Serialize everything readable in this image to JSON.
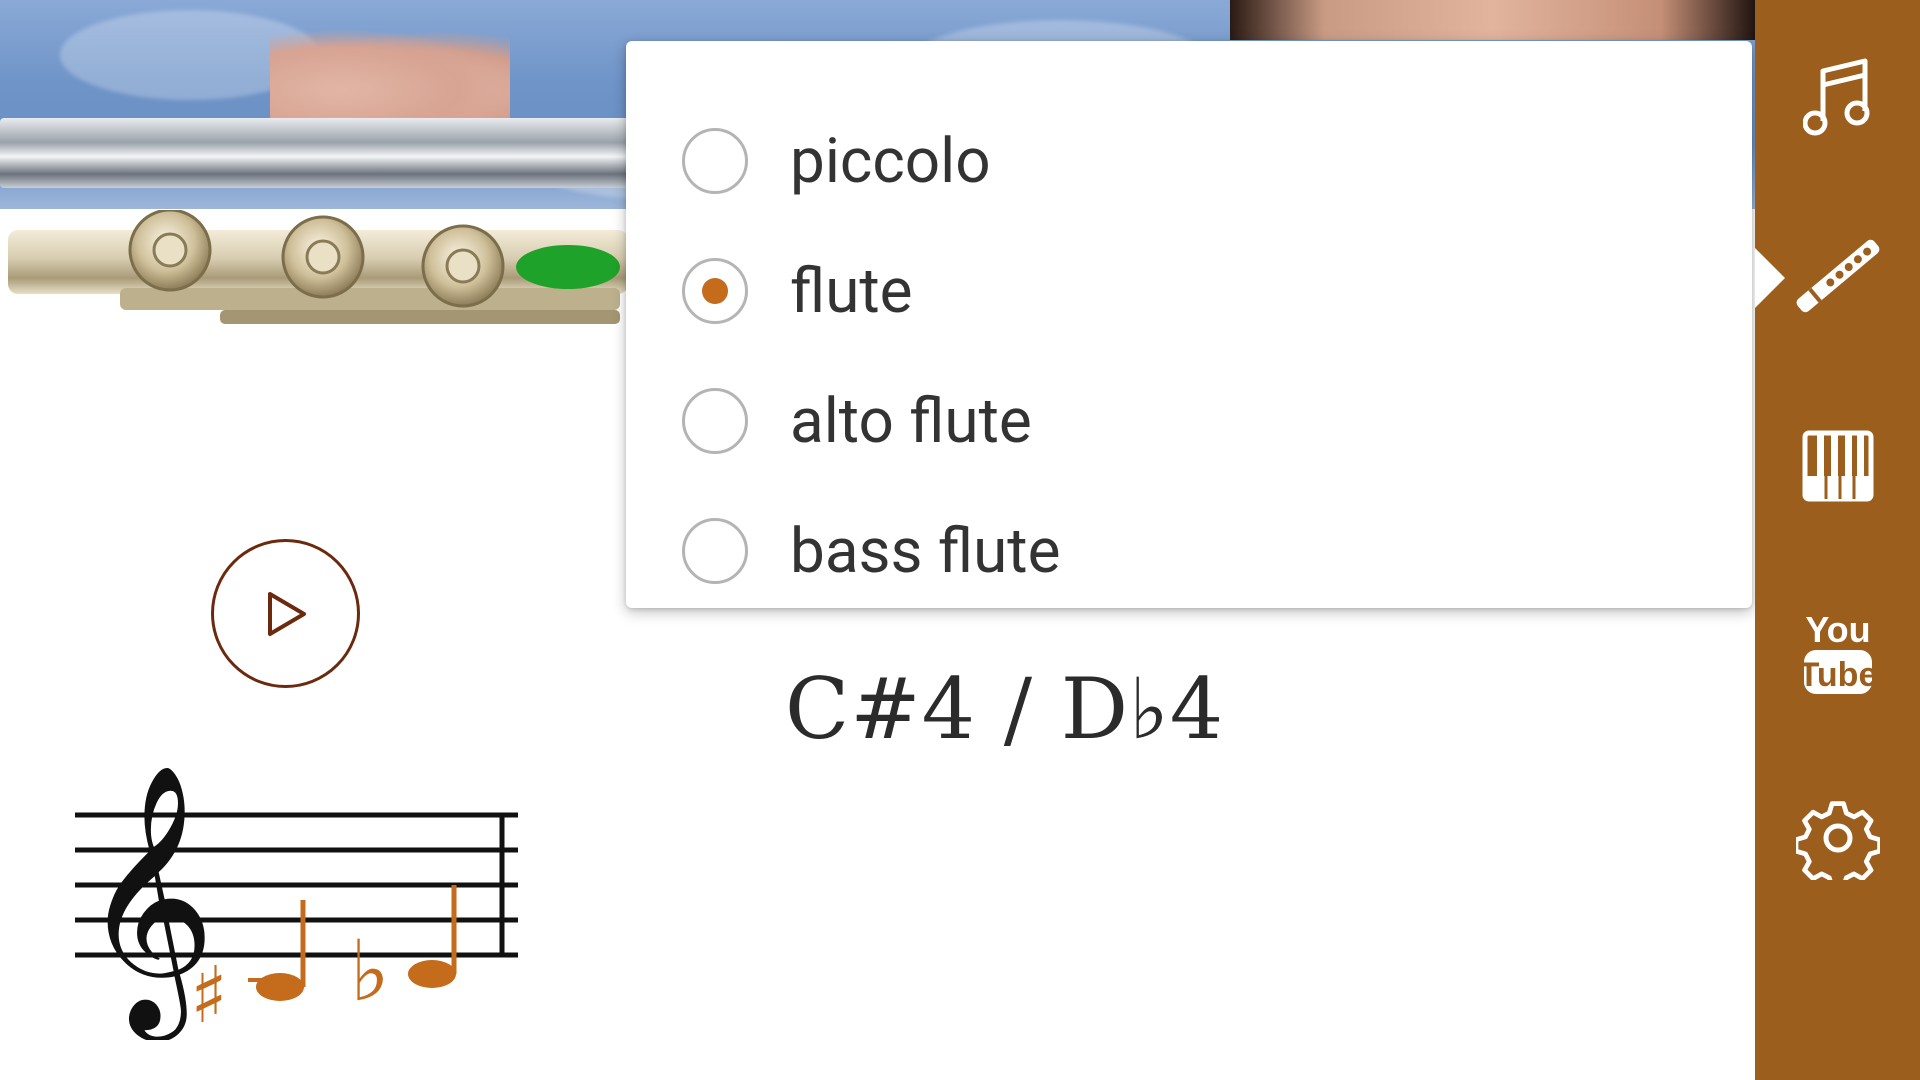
{
  "instrument_menu": {
    "options": [
      {
        "label": "piccolo",
        "selected": false
      },
      {
        "label": "flute",
        "selected": true
      },
      {
        "label": "alto flute",
        "selected": false
      },
      {
        "label": "bass flute",
        "selected": false
      }
    ]
  },
  "note": {
    "name": "C#4 / D♭4",
    "accidentals": [
      "♯",
      "♭"
    ]
  },
  "sidebar": {
    "items": [
      {
        "icon": "music-note-icon",
        "active": false
      },
      {
        "icon": "flute-icon",
        "active": true
      },
      {
        "icon": "piano-keyboard-icon",
        "active": false
      },
      {
        "icon": "youtube-icon",
        "label_top": "You",
        "label_bottom": "Tube",
        "active": false
      },
      {
        "icon": "gear-icon",
        "active": false
      }
    ]
  },
  "colors": {
    "sidebar_bg": "#9b5e1c",
    "accent": "#c56b1c",
    "play_outline": "#6b2a0e",
    "open_hole_indicator": "#1fa22a"
  }
}
